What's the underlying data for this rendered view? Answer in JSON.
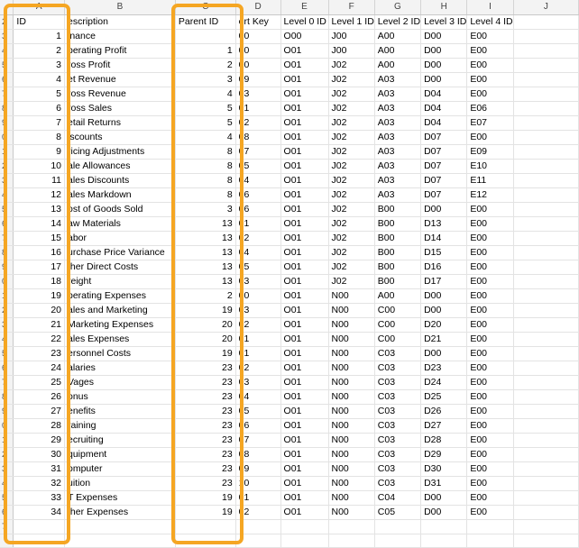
{
  "columns": [
    "A",
    "B",
    "C",
    "D",
    "E",
    "F",
    "G",
    "H",
    "I",
    "J"
  ],
  "header": [
    "ID",
    "escription",
    "Parent ID",
    "ort Key",
    "Level 0 ID",
    "Level 1 ID",
    "Level 2 ID",
    "Level 3 ID",
    "Level 4 ID",
    ""
  ],
  "row_numbers": [
    "2",
    "3",
    "4",
    "5",
    "6",
    "7",
    "8",
    "9",
    "0",
    "1",
    "2",
    "3",
    "4",
    "5",
    "6",
    "7",
    "8",
    "9",
    "0",
    "1",
    "2",
    "3",
    "4",
    "5",
    "6",
    "7",
    "8",
    "9",
    "0",
    "1",
    "2",
    "3",
    "4",
    "5",
    "6",
    "7"
  ],
  "rows": [
    [
      "1",
      "inance",
      "",
      "00",
      "O00",
      "J00",
      "A00",
      "D00",
      "E00",
      ""
    ],
    [
      "2",
      "perating Profit",
      "1",
      "00",
      "O01",
      "J00",
      "A00",
      "D00",
      "E00",
      ""
    ],
    [
      "3",
      "ross Profit",
      "2",
      "00",
      "O01",
      "J02",
      "A00",
      "D00",
      "E00",
      ""
    ],
    [
      "4",
      "et Revenue",
      "3",
      "09",
      "O01",
      "J02",
      "A03",
      "D00",
      "E00",
      ""
    ],
    [
      "5",
      "ross Revenue",
      "4",
      "03",
      "O01",
      "J02",
      "A03",
      "D04",
      "E00",
      ""
    ],
    [
      "6",
      "ross Sales",
      "5",
      "01",
      "O01",
      "J02",
      "A03",
      "D04",
      "E06",
      ""
    ],
    [
      "7",
      "etail Returns",
      "5",
      "02",
      "O01",
      "J02",
      "A03",
      "D04",
      "E07",
      ""
    ],
    [
      "8",
      "iscounts",
      "4",
      "08",
      "O01",
      "J02",
      "A03",
      "D07",
      "E00",
      ""
    ],
    [
      "9",
      "ricing Adjustments",
      "8",
      "07",
      "O01",
      "J02",
      "A03",
      "D07",
      "E09",
      ""
    ],
    [
      "10",
      "ale Allowances",
      "8",
      "05",
      "O01",
      "J02",
      "A03",
      "D07",
      "E10",
      ""
    ],
    [
      "11",
      "ales Discounts",
      "8",
      "04",
      "O01",
      "J02",
      "A03",
      "D07",
      "E11",
      ""
    ],
    [
      "12",
      "ales Markdown",
      "8",
      "06",
      "O01",
      "J02",
      "A03",
      "D07",
      "E12",
      ""
    ],
    [
      "13",
      "ost of Goods Sold",
      "3",
      "06",
      "O01",
      "J02",
      "B00",
      "D00",
      "E00",
      ""
    ],
    [
      "14",
      "aw Materials",
      "13",
      "01",
      "O01",
      "J02",
      "B00",
      "D13",
      "E00",
      ""
    ],
    [
      "15",
      "abor",
      "13",
      "02",
      "O01",
      "J02",
      "B00",
      "D14",
      "E00",
      ""
    ],
    [
      "16",
      "urchase Price Variance",
      "13",
      "04",
      "O01",
      "J02",
      "B00",
      "D15",
      "E00",
      ""
    ],
    [
      "17",
      "ther Direct Costs",
      "13",
      "05",
      "O01",
      "J02",
      "B00",
      "D16",
      "E00",
      ""
    ],
    [
      "18",
      "reight",
      "13",
      "03",
      "O01",
      "J02",
      "B00",
      "D17",
      "E00",
      ""
    ],
    [
      "19",
      "perating Expenses",
      "2",
      "00",
      "O01",
      "N00",
      "A00",
      "D00",
      "E00",
      ""
    ],
    [
      "20",
      "ales and Marketing",
      "19",
      "03",
      "O01",
      "N00",
      "C00",
      "D00",
      "E00",
      ""
    ],
    [
      "21",
      "Marketing Expenses",
      "20",
      "02",
      "O01",
      "N00",
      "C00",
      "D20",
      "E00",
      ""
    ],
    [
      "22",
      "ales Expenses",
      "20",
      "01",
      "O01",
      "N00",
      "C00",
      "D21",
      "E00",
      ""
    ],
    [
      "23",
      "ersonnel Costs",
      "19",
      "01",
      "O01",
      "N00",
      "C03",
      "D00",
      "E00",
      ""
    ],
    [
      "24",
      "alaries",
      "23",
      "02",
      "O01",
      "N00",
      "C03",
      "D23",
      "E00",
      ""
    ],
    [
      "25",
      "Vages",
      "23",
      "03",
      "O01",
      "N00",
      "C03",
      "D24",
      "E00",
      ""
    ],
    [
      "26",
      "onus",
      "23",
      "04",
      "O01",
      "N00",
      "C03",
      "D25",
      "E00",
      ""
    ],
    [
      "27",
      "enefits",
      "23",
      "05",
      "O01",
      "N00",
      "C03",
      "D26",
      "E00",
      ""
    ],
    [
      "28",
      "raining",
      "23",
      "06",
      "O01",
      "N00",
      "C03",
      "D27",
      "E00",
      ""
    ],
    [
      "29",
      "ecruiting",
      "23",
      "07",
      "O01",
      "N00",
      "C03",
      "D28",
      "E00",
      ""
    ],
    [
      "30",
      "quipment",
      "23",
      "08",
      "O01",
      "N00",
      "C03",
      "D29",
      "E00",
      ""
    ],
    [
      "31",
      "omputer",
      "23",
      "09",
      "O01",
      "N00",
      "C03",
      "D30",
      "E00",
      ""
    ],
    [
      "32",
      "uition",
      "23",
      "10",
      "O01",
      "N00",
      "C03",
      "D31",
      "E00",
      ""
    ],
    [
      "33",
      "T Expenses",
      "19",
      "01",
      "O01",
      "N00",
      "C04",
      "D00",
      "E00",
      ""
    ],
    [
      "34",
      "ther Expenses",
      "19",
      "02",
      "O01",
      "N00",
      "C05",
      "D00",
      "E00",
      ""
    ],
    [
      "",
      "",
      "",
      "",
      "",
      "",
      "",
      "",
      "",
      ""
    ],
    [
      "",
      "",
      "",
      "",
      "",
      "",
      "",
      "",
      "",
      ""
    ]
  ],
  "highlight_color": "#f5a623"
}
